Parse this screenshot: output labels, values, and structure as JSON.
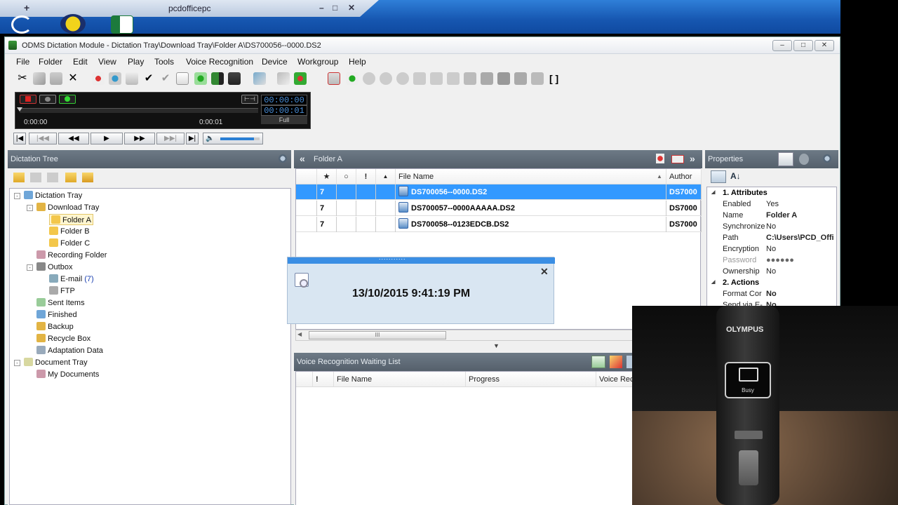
{
  "remote": {
    "title": "pcdofficepc",
    "controls": [
      "–",
      "□",
      "✕"
    ]
  },
  "window": {
    "title": "ODMS Dictation Module - Dictation Tray\\Download Tray\\Folder A\\DS700056--0000.DS2",
    "controls": [
      "–",
      "□",
      "✕"
    ]
  },
  "menu": [
    "File",
    "Folder",
    "Edit",
    "View",
    "Play",
    "Tools",
    "Voice Recognition",
    "Device",
    "Workgroup",
    "Help"
  ],
  "player": {
    "time_start": "0:00:00",
    "time_end": "0:00:01",
    "clock_top": "00:00:00",
    "clock_bottom": "00:00:01",
    "mode": "Full",
    "volume": 0.85
  },
  "dictation_tree": {
    "title": "Dictation Tree",
    "nodes": [
      {
        "label": "Dictation Tray",
        "level": 0
      },
      {
        "label": "Download Tray",
        "level": 1
      },
      {
        "label": "Folder A",
        "level": 2,
        "selected": true
      },
      {
        "label": "Folder B",
        "level": 2
      },
      {
        "label": "Folder C",
        "level": 2
      },
      {
        "label": "Recording Folder",
        "level": 1
      },
      {
        "label": "Outbox",
        "level": 1
      },
      {
        "label": "E-mail",
        "level": 2,
        "count": "(7)"
      },
      {
        "label": "FTP",
        "level": 2
      },
      {
        "label": "Sent Items",
        "level": 1
      },
      {
        "label": "Finished",
        "level": 1
      },
      {
        "label": "Backup",
        "level": 1
      },
      {
        "label": "Recycle Box",
        "level": 1
      },
      {
        "label": "Adaptation Data",
        "level": 1
      },
      {
        "label": "Document Tray",
        "level": 0
      },
      {
        "label": "My Documents",
        "level": 1
      }
    ]
  },
  "folder_panel": {
    "title": "Folder A",
    "columns": {
      "star": "★",
      "comment": "○",
      "priority": "!",
      "lock": "▲",
      "file": "File Name",
      "author": "Author"
    },
    "rows": [
      {
        "flag": "7",
        "file": "DS700056--0000.DS2",
        "author": "DS7000",
        "selected": true
      },
      {
        "flag": "7",
        "file": "DS700057--0000AAAAA.DS2",
        "author": "DS7000",
        "selected": false
      },
      {
        "flag": "7",
        "file": "DS700058--0123EDCB.DS2",
        "author": "DS7000",
        "selected": false
      }
    ]
  },
  "popup": {
    "grip": "...........",
    "datetime": "13/10/2015 9:41:19 PM",
    "close": "✕"
  },
  "scroll_marker": "III",
  "vr_panel": {
    "title": "Voice Recognition Waiting List",
    "columns": [
      "!",
      "File Name",
      "Progress",
      "Voice Rec"
    ]
  },
  "properties": {
    "title": "Properties",
    "sections": [
      {
        "label": "1. Attributes",
        "items": [
          {
            "key": "Enabled",
            "value": "Yes",
            "bold": false
          },
          {
            "key": "Name",
            "value": "Folder A",
            "bold": true
          },
          {
            "key": "Synchronize",
            "value": "No",
            "bold": false
          },
          {
            "key": "Path",
            "value": "C:\\Users\\PCD_Offi",
            "bold": true
          },
          {
            "key": "Encryption",
            "value": "No",
            "bold": false
          },
          {
            "key": "Password",
            "value": "●●●●●●",
            "bold": false,
            "dim": true
          },
          {
            "key": "Ownership",
            "value": "No",
            "bold": false
          }
        ]
      },
      {
        "label": "2. Actions",
        "items": [
          {
            "key": "Format Cor",
            "value": "No",
            "bold": true
          },
          {
            "key": "Send via E-",
            "value": "No",
            "bold": true
          }
        ]
      }
    ]
  },
  "camera": {
    "brand": "OLYMPUS",
    "screen_label": "Busy"
  },
  "colors": {
    "selection": "#3399ff",
    "panel_header": "#5e6a75",
    "popup_bar": "#3a8ee4",
    "clock_text": "#4a8fd9"
  }
}
